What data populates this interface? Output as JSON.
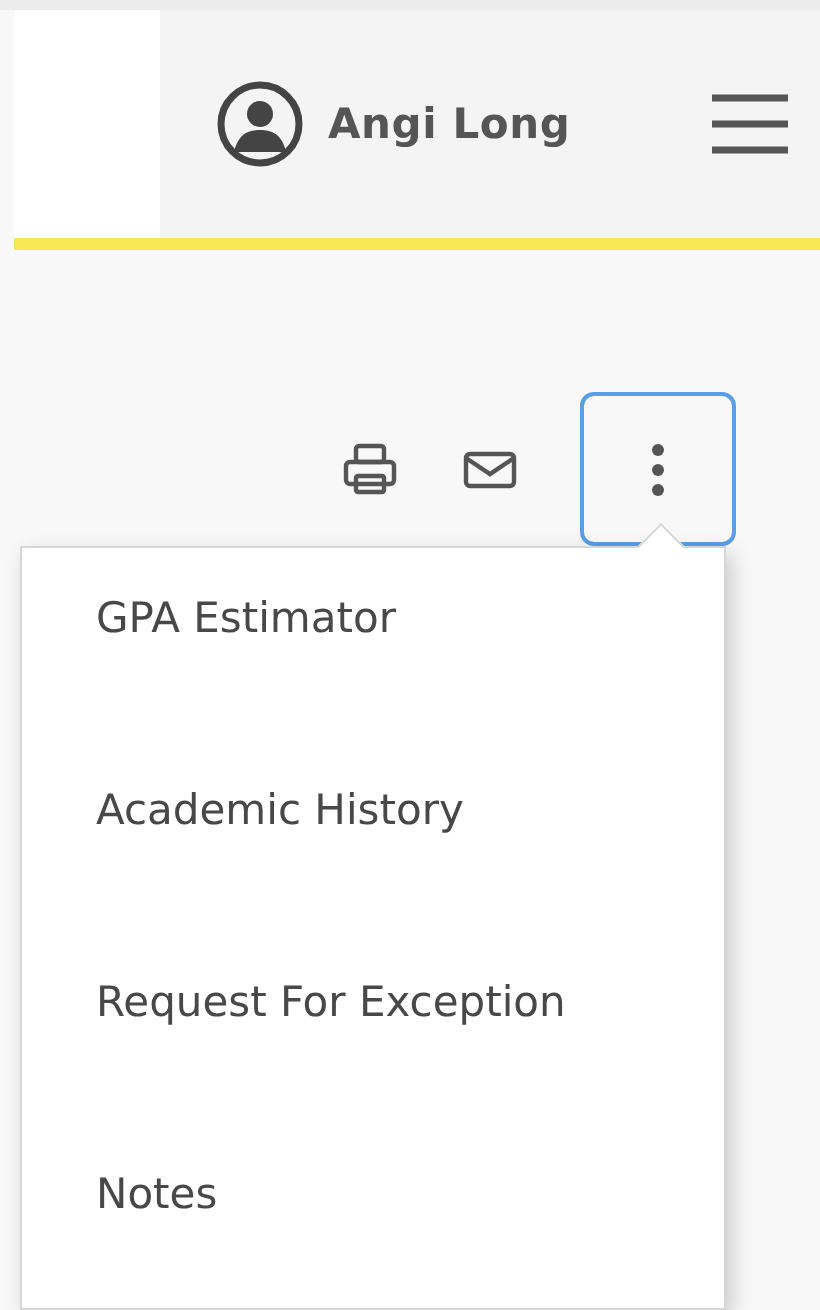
{
  "header": {
    "user_name": "Angi Long"
  },
  "toolbar": {
    "more_menu_expanded": true
  },
  "menu": {
    "items": [
      {
        "label": "GPA Estimator"
      },
      {
        "label": "Academic History"
      },
      {
        "label": "Request For Exception"
      },
      {
        "label": "Notes"
      }
    ]
  }
}
